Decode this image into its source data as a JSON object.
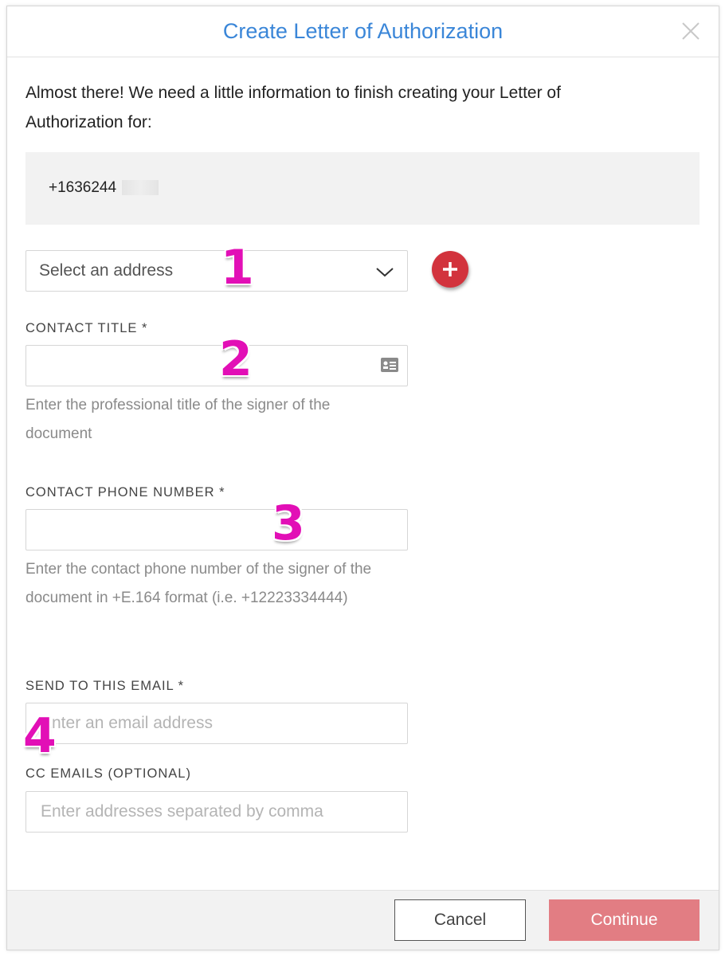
{
  "dialog": {
    "title": "Create Letter of Authorization",
    "close_icon": "close-icon"
  },
  "intro": {
    "text": "Almost there! We need a little information to finish creating your Letter of Authorization for:"
  },
  "phone_number": {
    "visible": "+1636244",
    "redacted": true
  },
  "address_select": {
    "placeholder": "Select an address",
    "add_icon": "plus-icon"
  },
  "contact_title": {
    "label": "CONTACT TITLE *",
    "value": "",
    "help": "Enter the professional title of the signer of the document",
    "icon": "contact-card-icon"
  },
  "contact_phone": {
    "label": "CONTACT PHONE NUMBER *",
    "value": "",
    "help": "Enter the contact phone number of the signer of the document in +E.164 format (i.e. +12223334444)"
  },
  "send_email": {
    "label": "SEND TO THIS EMAIL *",
    "placeholder": "Enter an email address"
  },
  "cc_emails": {
    "label": "CC EMAILS (OPTIONAL)",
    "placeholder": "Enter addresses separated by comma"
  },
  "annotations": [
    "1",
    "2",
    "3",
    "4"
  ],
  "footer": {
    "cancel_label": "Cancel",
    "continue_label": "Continue"
  },
  "colors": {
    "title": "#3a86d8",
    "add_button": "#d2333d",
    "continue_button": "#e27d83",
    "annotation": "#e20fb6"
  }
}
